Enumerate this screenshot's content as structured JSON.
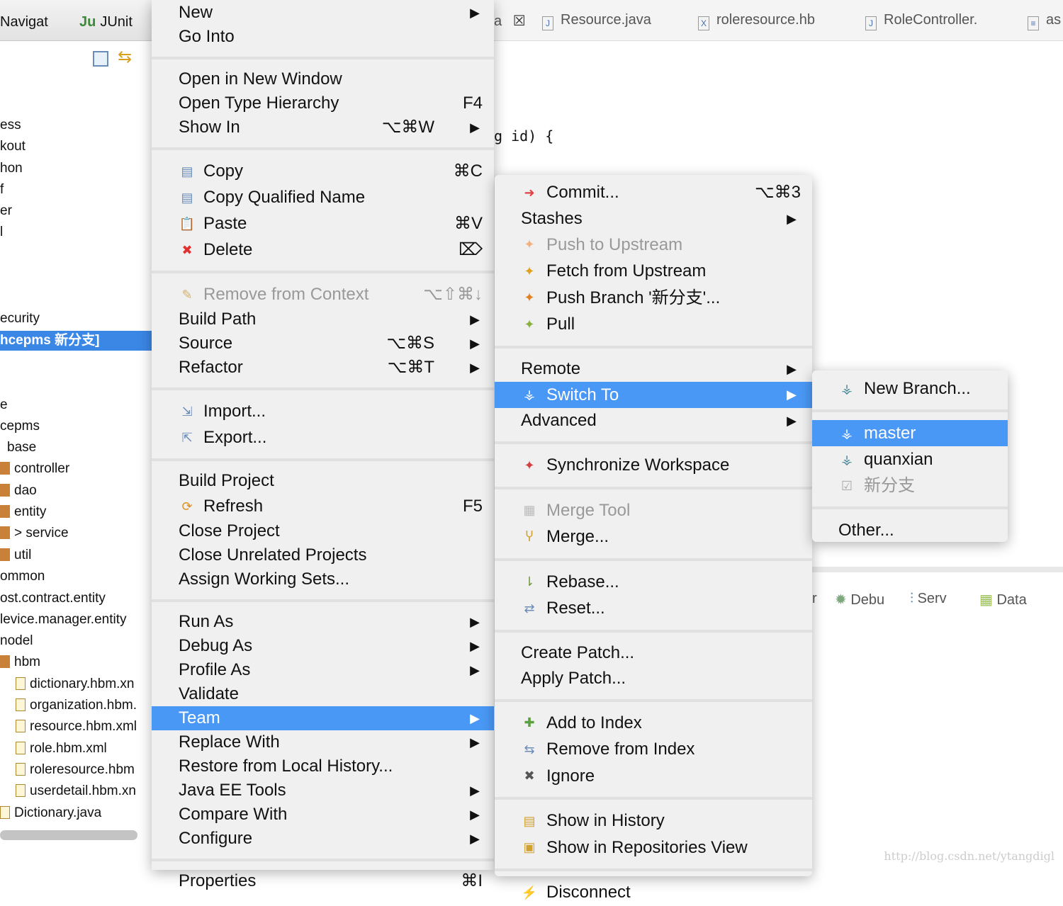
{
  "left_panel": {
    "tabs": [
      {
        "icon": "navigator-icon",
        "label": "Navigat"
      },
      {
        "icon": "junit-icon",
        "label": "JUnit"
      }
    ],
    "tree": [
      {
        "label": "ess"
      },
      {
        "label": "kout"
      },
      {
        "label": "hon"
      },
      {
        "label": "f"
      },
      {
        "label": "er"
      },
      {
        "label": "l"
      },
      {
        "label": "ecurity"
      },
      {
        "label": "hcepms 新分支]",
        "selected": true
      },
      {
        "label": "e"
      },
      {
        "label": "cepms"
      },
      {
        "label": "base"
      },
      {
        "label": "controller",
        "icon": "package"
      },
      {
        "label": "dao",
        "icon": "package"
      },
      {
        "label": "entity",
        "icon": "package"
      },
      {
        "label": "> service",
        "icon": "package"
      },
      {
        "label": "util",
        "icon": "package"
      },
      {
        "label": "ommon"
      },
      {
        "label": "ost.contract.entity"
      },
      {
        "label": "levice.manager.entity"
      },
      {
        "label": "nodel"
      },
      {
        "label": "hbm",
        "icon": "package"
      },
      {
        "label": "dictionary.hbm.xn",
        "icon": "xml"
      },
      {
        "label": "organization.hbm.",
        "icon": "xml"
      },
      {
        "label": "resource.hbm.xml",
        "icon": "xml"
      },
      {
        "label": "role.hbm.xml",
        "icon": "xml"
      },
      {
        "label": "roleresource.hbm",
        "icon": "xml"
      },
      {
        "label": "userdetail.hbm.xn",
        "icon": "xml"
      },
      {
        "label": "Dictionary.java",
        "icon": "java"
      }
    ]
  },
  "editor": {
    "tabs": [
      "a",
      "Resource.java",
      "roleresource.hb",
      "RoleController.",
      "as"
    ],
    "code_line": "g id) {",
    "bottom_tabs": [
      "r",
      "Debu",
      "Serv",
      "Data"
    ]
  },
  "watermark": "http://blog.csdn.net/ytangdigl",
  "context_menu": [
    {
      "label": "New",
      "arrow": true
    },
    {
      "label": "Go Into"
    },
    {
      "sep": true
    },
    {
      "label": "Open in New Window"
    },
    {
      "label": "Open Type Hierarchy",
      "shortcut": "F4"
    },
    {
      "label": "Show In",
      "shortcut": "⌥⌘W",
      "arrow": true
    },
    {
      "sep": true
    },
    {
      "label": "Copy",
      "icon": "copy-icon",
      "shortcut": "⌘C"
    },
    {
      "label": "Copy Qualified Name",
      "icon": "copy-qualified-icon"
    },
    {
      "label": "Paste",
      "icon": "paste-icon",
      "shortcut": "⌘V"
    },
    {
      "label": "Delete",
      "icon": "delete-icon",
      "shortcut": "⌦"
    },
    {
      "sep": true
    },
    {
      "label": "Remove from Context",
      "icon": "remove-context-icon",
      "shortcut": "⌥⇧⌘↓",
      "disabled": true
    },
    {
      "label": "Build Path",
      "arrow": true
    },
    {
      "label": "Source",
      "shortcut": "⌥⌘S",
      "arrow": true
    },
    {
      "label": "Refactor",
      "shortcut": "⌥⌘T",
      "arrow": true
    },
    {
      "sep": true
    },
    {
      "label": "Import...",
      "icon": "import-icon"
    },
    {
      "label": "Export...",
      "icon": "export-icon"
    },
    {
      "sep": true
    },
    {
      "label": "Build Project"
    },
    {
      "label": "Refresh",
      "icon": "refresh-icon",
      "shortcut": "F5"
    },
    {
      "label": "Close Project"
    },
    {
      "label": "Close Unrelated Projects"
    },
    {
      "label": "Assign Working Sets..."
    },
    {
      "sep": true
    },
    {
      "label": "Run As",
      "arrow": true
    },
    {
      "label": "Debug As",
      "arrow": true
    },
    {
      "label": "Profile As",
      "arrow": true
    },
    {
      "label": "Validate"
    },
    {
      "label": "Team",
      "arrow": true,
      "highlighted": true
    },
    {
      "label": "Replace With",
      "arrow": true
    },
    {
      "label": "Restore from Local History..."
    },
    {
      "label": "Java EE Tools",
      "arrow": true
    },
    {
      "label": "Compare With",
      "arrow": true
    },
    {
      "label": "Configure",
      "arrow": true
    },
    {
      "sep": true
    },
    {
      "label": "Properties",
      "shortcut": "⌘I"
    }
  ],
  "team_menu": [
    {
      "label": "Commit...",
      "icon": "commit-icon",
      "shortcut": "⌥⌘3"
    },
    {
      "label": "Stashes",
      "arrow": true
    },
    {
      "label": "Push to Upstream",
      "icon": "push-icon",
      "disabled": true
    },
    {
      "label": "Fetch from Upstream",
      "icon": "fetch-icon"
    },
    {
      "label": "Push Branch '新分支'...",
      "icon": "push-branch-icon"
    },
    {
      "label": "Pull",
      "icon": "pull-icon"
    },
    {
      "sep": true
    },
    {
      "label": "Remote",
      "arrow": true
    },
    {
      "label": "Switch To",
      "icon": "branch-icon",
      "arrow": true,
      "highlighted": true
    },
    {
      "label": "Advanced",
      "arrow": true
    },
    {
      "sep": true
    },
    {
      "label": "Synchronize Workspace",
      "icon": "synchronize-icon"
    },
    {
      "sep": true
    },
    {
      "label": "Merge Tool",
      "icon": "merge-tool-icon",
      "disabled": true
    },
    {
      "label": "Merge...",
      "icon": "merge-icon"
    },
    {
      "sep": true
    },
    {
      "label": "Rebase...",
      "icon": "rebase-icon"
    },
    {
      "label": "Reset...",
      "icon": "reset-icon"
    },
    {
      "sep": true
    },
    {
      "label": "Create Patch..."
    },
    {
      "label": "Apply Patch..."
    },
    {
      "sep": true
    },
    {
      "label": "Add to Index",
      "icon": "add-index-icon"
    },
    {
      "label": "Remove from Index",
      "icon": "remove-index-icon"
    },
    {
      "label": "Ignore",
      "icon": "ignore-icon"
    },
    {
      "sep": true
    },
    {
      "label": "Show in History",
      "icon": "history-icon"
    },
    {
      "label": "Show in Repositories View",
      "icon": "repositories-icon"
    },
    {
      "sep": true
    },
    {
      "label": "Disconnect",
      "icon": "disconnect-icon"
    }
  ],
  "switch_menu": [
    {
      "label": "New Branch...",
      "icon": "new-branch-icon"
    },
    {
      "sep": true
    },
    {
      "label": "master",
      "icon": "branch-icon",
      "highlighted": true
    },
    {
      "label": "quanxian",
      "icon": "branch-icon"
    },
    {
      "label": "新分支",
      "icon": "checked-branch-icon",
      "disabled": true
    },
    {
      "sep": true
    },
    {
      "label": "Other..."
    }
  ],
  "colors": {
    "highlight": "#4a98f5",
    "selection": "#3b87e6",
    "disabled": "#999999"
  }
}
